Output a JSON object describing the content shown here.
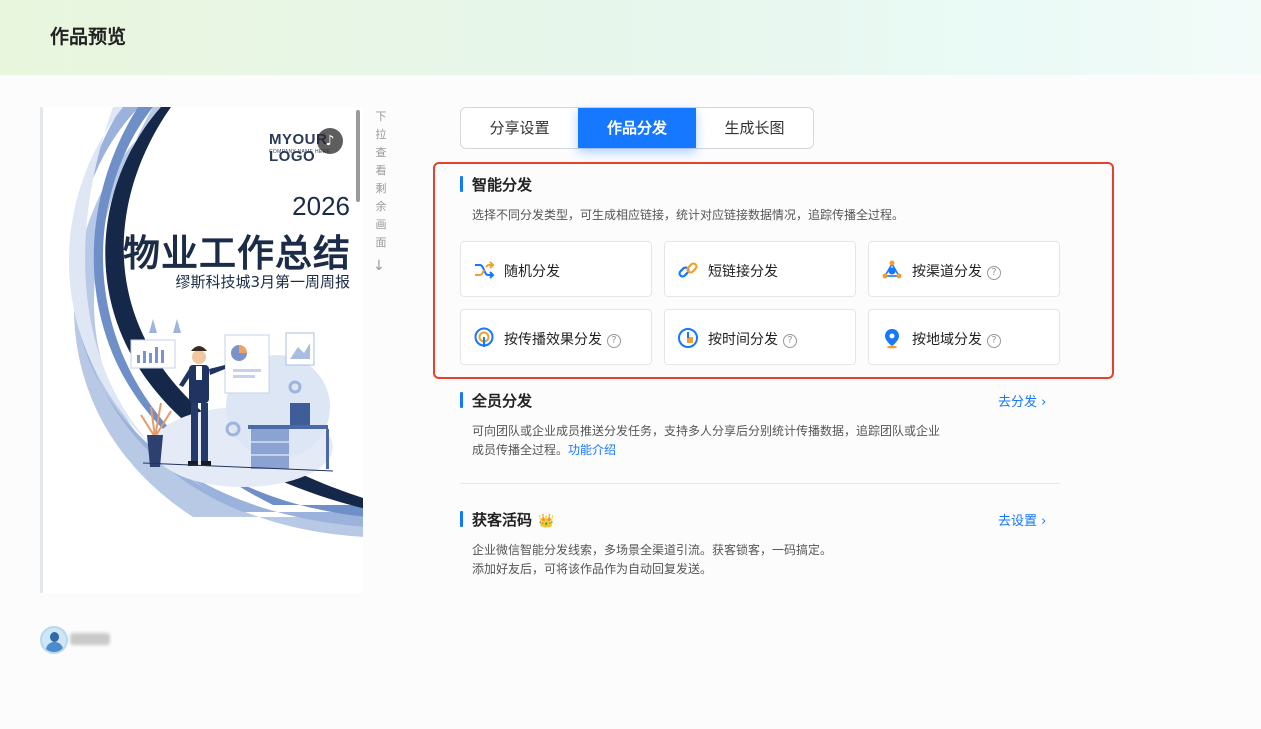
{
  "header": {
    "title": "作品预览"
  },
  "preview": {
    "logo_text": "MYOUR LOGO",
    "logo_sub": "COMPANY NAME HERE",
    "year": "2026",
    "title": "物业工作总结",
    "subtitle": "缪斯科技城3月第一周周报",
    "scroll_hint": "下拉查看剩余画面",
    "scroll_arrow": "↓",
    "music_icon": "music-note-icon"
  },
  "tabs": [
    {
      "label": "分享设置",
      "active": false
    },
    {
      "label": "作品分发",
      "active": true
    },
    {
      "label": "生成长图",
      "active": false
    }
  ],
  "smart": {
    "title": "智能分发",
    "desc": "选择不同分发类型，可生成相应链接，统计对应链接数据情况，追踪传播全过程。",
    "cards": [
      {
        "label": "随机分发",
        "icon": "shuffle-icon",
        "help": ""
      },
      {
        "label": "短链接分发",
        "icon": "link-icon",
        "help": ""
      },
      {
        "label": "按渠道分发",
        "icon": "channel-icon",
        "help": "?"
      },
      {
        "label": "按传播效果分发",
        "icon": "broadcast-icon",
        "help": "?"
      },
      {
        "label": "按时间分发",
        "icon": "clock-icon",
        "help": "?"
      },
      {
        "label": "按地域分发",
        "icon": "location-pin-icon",
        "help": "?"
      }
    ]
  },
  "staff": {
    "title": "全员分发",
    "link": "去分发 ›",
    "desc_line1": "可向团队或企业成员推送分发任务，支持多人分享后分别统计传播数据，追踪团队或企业",
    "desc_line2": "成员传播全过程。",
    "feature_link": "功能介绍"
  },
  "acquire": {
    "title": "获客活码",
    "badge_icon": "crown-badge-icon",
    "link": "去设置 ›",
    "desc_line1": "企业微信智能分发线索，多场景全渠道引流。获客锁客，一码搞定。",
    "desc_line2": "添加好友后，可将该作品作为自动回复发送。"
  },
  "colors": {
    "accent": "#1677ff",
    "highlight_border": "#e8402b",
    "poster_navy": "#1c2c48"
  }
}
